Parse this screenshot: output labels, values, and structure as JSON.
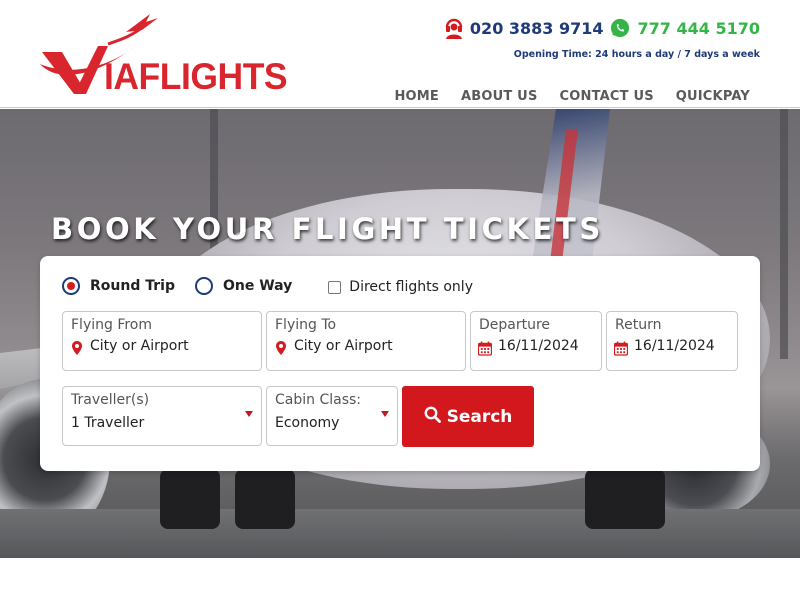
{
  "brand": {
    "logo_text": "IAFLIGHTS",
    "accent": "#d2181d",
    "navy": "#1f3a78",
    "green": "#35b548"
  },
  "contact": {
    "phone": "020 3883 9714",
    "whatsapp": "777 444 5170",
    "opening": "Opening Time: 24 hours a day / 7 days a week",
    "phone_icon": "headset-icon",
    "whatsapp_icon": "whatsapp-icon"
  },
  "nav": {
    "items": [
      {
        "label": "HOME"
      },
      {
        "label": "ABOUT US"
      },
      {
        "label": "CONTACT US"
      },
      {
        "label": "QUICKPAY"
      }
    ]
  },
  "hero": {
    "title": "BOOK YOUR FLIGHT TICKETS"
  },
  "search": {
    "trip_types": [
      {
        "label": "Round Trip",
        "checked": true
      },
      {
        "label": "One Way",
        "checked": false
      }
    ],
    "direct_only": {
      "label": "Direct flights only",
      "checked": false
    },
    "flying_from": {
      "label": "Flying From",
      "placeholder": "City or Airport",
      "icon": "map-pin-icon"
    },
    "flying_to": {
      "label": "Flying To",
      "placeholder": "City or Airport",
      "icon": "map-pin-icon"
    },
    "departure": {
      "label": "Departure",
      "value": "16/11/2024",
      "icon": "calendar-icon"
    },
    "return": {
      "label": "Return",
      "value": "16/11/2024",
      "icon": "calendar-icon"
    },
    "travellers": {
      "label": "Traveller(s)",
      "value": "1 Traveller"
    },
    "cabin": {
      "label": "Cabin Class:",
      "value": "Economy"
    },
    "button_label": "Search",
    "button_icon": "search-icon"
  }
}
